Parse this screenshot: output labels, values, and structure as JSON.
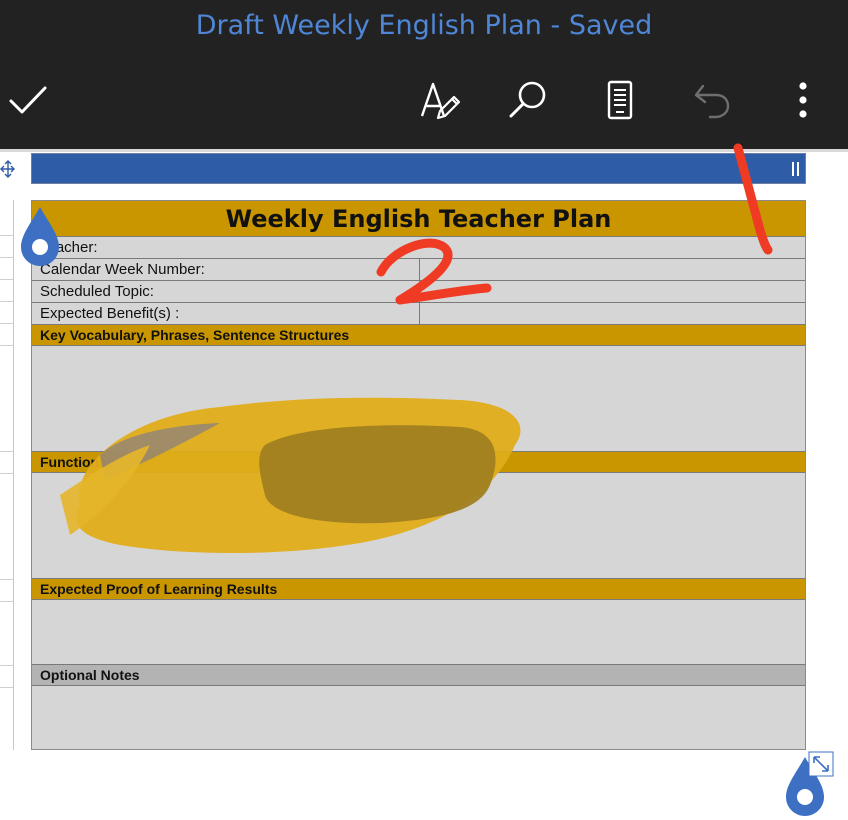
{
  "app": {
    "title": "Draft Weekly English Plan - Saved",
    "accent_color": "#4f86d6",
    "bar_color": "#222222"
  },
  "toolbar": {
    "buttons": [
      {
        "icon": "checkmark-icon",
        "name": "done-button"
      },
      {
        "icon": "pen-format-icon",
        "name": "format-button"
      },
      {
        "icon": "search-icon",
        "name": "find-button"
      },
      {
        "icon": "mobile-view-icon",
        "name": "view-button"
      },
      {
        "icon": "undo-icon",
        "name": "undo-button",
        "enabled": false
      },
      {
        "icon": "more-vertical-icon",
        "name": "more-button"
      }
    ]
  },
  "plan": {
    "title": "Weekly English Teacher Plan",
    "fields": [
      {
        "label": "Teacher:"
      },
      {
        "label": "Calendar Week Number:"
      },
      {
        "label": "Scheduled Topic:"
      },
      {
        "label": "Expected Benefit(s) :"
      }
    ],
    "sections": [
      {
        "label": "Key Vocabulary, Phrases, Sentence Structures",
        "color": "#c99600"
      },
      {
        "label": "Functional",
        "color": "#c99600"
      },
      {
        "label": "Expected Proof of Learning Results",
        "color": "#c99600"
      },
      {
        "label": "Optional Notes",
        "color": "#b3b3b3"
      }
    ],
    "header_color": "#c99600",
    "band_color": "#2f5ca6"
  },
  "annotations": {
    "marks": [
      "1",
      "2"
    ],
    "color": "#ef3b24"
  }
}
